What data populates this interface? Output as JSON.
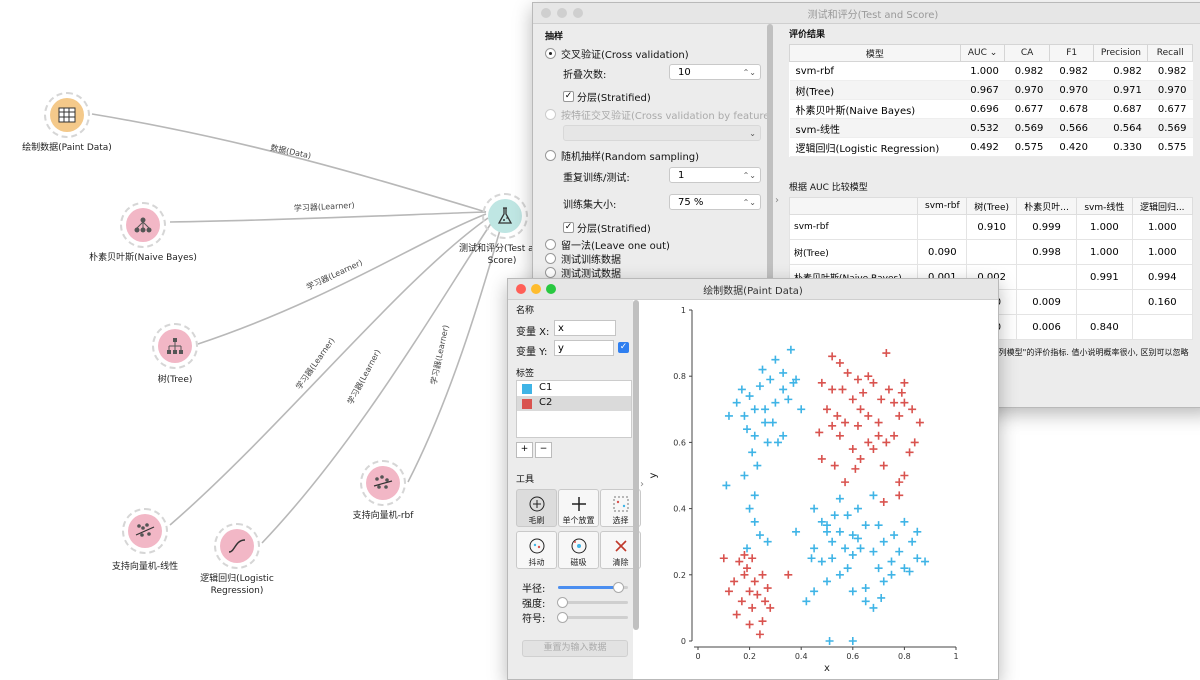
{
  "canvas": {
    "nodes": {
      "paint": {
        "label": "绘制数据(Paint Data)",
        "color": "#f4c98a"
      },
      "naive": {
        "label": "朴素贝叶斯(Naive Bayes)",
        "color": "#f2b7c6"
      },
      "tree": {
        "label": "树(Tree)",
        "color": "#f2b7c6"
      },
      "svm_linear": {
        "label": "支持向量机-线性",
        "color": "#f2b7c6"
      },
      "logreg": {
        "label": "逻辑回归(Logistic Regression)",
        "color": "#f2b7c6"
      },
      "svm_rbf": {
        "label": "支持向量机-rbf",
        "color": "#f2b7c6"
      },
      "test": {
        "label": "测试和评分(Test and Score)",
        "color": "#bfe6e3"
      }
    },
    "edges": {
      "data": "数据(Data)",
      "learner": "学习器(Learner)"
    }
  },
  "ts": {
    "title": "测试和评分(Test and Score)",
    "sampling_title": "抽样",
    "cv": "交叉验证(Cross validation)",
    "folds_label": "折叠次数:",
    "folds": "10",
    "stratified": "分层(Stratified)",
    "cv_feature": "按特征交叉验证(Cross validation by feature)",
    "random": "随机抽样(Random sampling)",
    "repeat_label": "重复训练/测试:",
    "repeat": "1",
    "size_label": "训练集大小:",
    "size": "75 %",
    "stratified2": "分层(Stratified)",
    "loo": "留一法(Leave one out)",
    "test_train": "测试训练数据",
    "test_test": "测试测试数据",
    "results_title": "评价结果",
    "cols": [
      "模型",
      "AUC ⌄",
      "CA",
      "F1",
      "Precision",
      "Recall"
    ],
    "rows": [
      [
        "svm-rbf",
        "1.000",
        "0.982",
        "0.982",
        "0.982",
        "0.982"
      ],
      [
        "树(Tree)",
        "0.967",
        "0.970",
        "0.970",
        "0.971",
        "0.970"
      ],
      [
        "朴素贝叶斯(Naive Bayes)",
        "0.696",
        "0.677",
        "0.678",
        "0.687",
        "0.677"
      ],
      [
        "svm-线性",
        "0.532",
        "0.569",
        "0.566",
        "0.564",
        "0.569"
      ],
      [
        "逻辑回归(Logistic Regression)",
        "0.492",
        "0.575",
        "0.420",
        "0.330",
        "0.575"
      ]
    ],
    "compare_title": "根据 AUC 比较模型",
    "cmp_cols": [
      "",
      "svm-rbf",
      "树(Tree)",
      "朴素贝叶...",
      "svm-线性",
      "逻辑回归..."
    ],
    "cmp_rows": [
      [
        "svm-rbf",
        "",
        "0.910",
        "0.999",
        "1.000",
        "1.000"
      ],
      [
        "树(Tree)",
        "0.090",
        "",
        "0.998",
        "1.000",
        "1.000"
      ],
      [
        "朴素贝叶斯(Naive Bayes)",
        "0.001",
        "0.002",
        "",
        "0.991",
        "0.994"
      ],
      [
        "",
        "",
        "000",
        "0.009",
        "",
        "0.160"
      ],
      [
        "",
        "",
        "000",
        "0.006",
        "0.840",
        ""
      ]
    ],
    "note": "\"列模型\"的评价指标. 值小说明概率很小, 区别可以忽略"
  },
  "pd": {
    "title": "绘制数据(Paint Data)",
    "name_title": "名称",
    "varx_label": "变量 X:",
    "varx": "x",
    "vary_label": "变量 Y:",
    "vary": "y",
    "labels_title": "标签",
    "labels": [
      {
        "name": "C1",
        "color": "#3fb4e6"
      },
      {
        "name": "C2",
        "color": "#d9534f"
      }
    ],
    "add": "+",
    "remove": "−",
    "tools_title": "工具",
    "tools": [
      "毛刷",
      "单个放置",
      "选择",
      "抖动",
      "磁吸",
      "清除"
    ],
    "radius_label": "半径:",
    "intensity_label": "强度:",
    "symbol_label": "符号:",
    "reset": "重置为输入数据",
    "radius_value": 0.85,
    "intensity_value": 0.05,
    "symbol_value": 0.05
  },
  "chart_data": {
    "type": "scatter",
    "xlabel": "x",
    "ylabel": "y",
    "xlim": [
      0,
      1
    ],
    "ylim": [
      0,
      1
    ],
    "xticks": [
      "0",
      "0.2",
      "0.4",
      "0.6",
      "0.8",
      "1"
    ],
    "yticks": [
      "0",
      "0.2",
      "0.4",
      "0.6",
      "0.8",
      "1"
    ],
    "series": [
      {
        "name": "C1",
        "color": "#3fb4e6",
        "points": [
          [
            0.3,
            0.85
          ],
          [
            0.36,
            0.88
          ],
          [
            0.33,
            0.81
          ],
          [
            0.38,
            0.79
          ],
          [
            0.25,
            0.82
          ],
          [
            0.28,
            0.79
          ],
          [
            0.2,
            0.74
          ],
          [
            0.22,
            0.7
          ],
          [
            0.18,
            0.68
          ],
          [
            0.26,
            0.66
          ],
          [
            0.3,
            0.72
          ],
          [
            0.33,
            0.76
          ],
          [
            0.35,
            0.73
          ],
          [
            0.4,
            0.7
          ],
          [
            0.37,
            0.78
          ],
          [
            0.24,
            0.77
          ],
          [
            0.15,
            0.72
          ],
          [
            0.12,
            0.68
          ],
          [
            0.19,
            0.64
          ],
          [
            0.22,
            0.62
          ],
          [
            0.27,
            0.6
          ],
          [
            0.31,
            0.6
          ],
          [
            0.33,
            0.62
          ],
          [
            0.21,
            0.57
          ],
          [
            0.23,
            0.53
          ],
          [
            0.18,
            0.5
          ],
          [
            0.11,
            0.47
          ],
          [
            0.29,
            0.66
          ],
          [
            0.17,
            0.76
          ],
          [
            0.26,
            0.7
          ],
          [
            0.2,
            0.4
          ],
          [
            0.22,
            0.36
          ],
          [
            0.24,
            0.32
          ],
          [
            0.19,
            0.28
          ],
          [
            0.27,
            0.3
          ],
          [
            0.22,
            0.44
          ],
          [
            0.38,
            0.33
          ],
          [
            0.45,
            0.28
          ],
          [
            0.48,
            0.36
          ],
          [
            0.5,
            0.33
          ],
          [
            0.52,
            0.3
          ],
          [
            0.55,
            0.33
          ],
          [
            0.57,
            0.28
          ],
          [
            0.6,
            0.26
          ],
          [
            0.62,
            0.31
          ],
          [
            0.65,
            0.35
          ],
          [
            0.68,
            0.27
          ],
          [
            0.7,
            0.22
          ],
          [
            0.72,
            0.18
          ],
          [
            0.75,
            0.24
          ],
          [
            0.78,
            0.27
          ],
          [
            0.8,
            0.22
          ],
          [
            0.83,
            0.3
          ],
          [
            0.85,
            0.25
          ],
          [
            0.88,
            0.24
          ],
          [
            0.58,
            0.22
          ],
          [
            0.52,
            0.25
          ],
          [
            0.48,
            0.24
          ],
          [
            0.44,
            0.25
          ],
          [
            0.42,
            0.12
          ],
          [
            0.45,
            0.15
          ],
          [
            0.5,
            0.18
          ],
          [
            0.55,
            0.2
          ],
          [
            0.6,
            0.15
          ],
          [
            0.65,
            0.12
          ],
          [
            0.65,
            0.16
          ],
          [
            0.71,
            0.13
          ],
          [
            0.68,
            0.1
          ],
          [
            0.75,
            0.2
          ],
          [
            0.62,
            0.4
          ],
          [
            0.68,
            0.44
          ],
          [
            0.7,
            0.35
          ],
          [
            0.72,
            0.3
          ],
          [
            0.76,
            0.32
          ],
          [
            0.8,
            0.36
          ],
          [
            0.58,
            0.38
          ],
          [
            0.55,
            0.43
          ],
          [
            0.6,
            0.32
          ],
          [
            0.63,
            0.28
          ],
          [
            0.45,
            0.4
          ],
          [
            0.5,
            0.35
          ],
          [
            0.53,
            0.38
          ],
          [
            0.85,
            0.33
          ],
          [
            0.82,
            0.21
          ],
          [
            0.6,
            0.0
          ],
          [
            0.51,
            0.0
          ]
        ]
      },
      {
        "name": "C2",
        "color": "#d9534f",
        "points": [
          [
            0.52,
            0.86
          ],
          [
            0.55,
            0.84
          ],
          [
            0.58,
            0.81
          ],
          [
            0.62,
            0.79
          ],
          [
            0.66,
            0.8
          ],
          [
            0.73,
            0.87
          ],
          [
            0.8,
            0.78
          ],
          [
            0.68,
            0.78
          ],
          [
            0.74,
            0.76
          ],
          [
            0.76,
            0.72
          ],
          [
            0.71,
            0.73
          ],
          [
            0.64,
            0.75
          ],
          [
            0.6,
            0.73
          ],
          [
            0.56,
            0.76
          ],
          [
            0.52,
            0.76
          ],
          [
            0.48,
            0.78
          ],
          [
            0.5,
            0.7
          ],
          [
            0.54,
            0.68
          ],
          [
            0.57,
            0.66
          ],
          [
            0.62,
            0.65
          ],
          [
            0.63,
            0.7
          ],
          [
            0.66,
            0.68
          ],
          [
            0.7,
            0.62
          ],
          [
            0.73,
            0.6
          ],
          [
            0.76,
            0.62
          ],
          [
            0.78,
            0.68
          ],
          [
            0.8,
            0.72
          ],
          [
            0.83,
            0.7
          ],
          [
            0.79,
            0.75
          ],
          [
            0.86,
            0.66
          ],
          [
            0.84,
            0.6
          ],
          [
            0.82,
            0.57
          ],
          [
            0.8,
            0.5
          ],
          [
            0.78,
            0.48
          ],
          [
            0.72,
            0.53
          ],
          [
            0.68,
            0.58
          ],
          [
            0.63,
            0.55
          ],
          [
            0.6,
            0.58
          ],
          [
            0.55,
            0.62
          ],
          [
            0.52,
            0.65
          ],
          [
            0.47,
            0.63
          ],
          [
            0.48,
            0.55
          ],
          [
            0.53,
            0.53
          ],
          [
            0.57,
            0.48
          ],
          [
            0.61,
            0.52
          ],
          [
            0.78,
            0.44
          ],
          [
            0.72,
            0.42
          ],
          [
            0.66,
            0.6
          ],
          [
            0.7,
            0.66
          ],
          [
            0.16,
            0.24
          ],
          [
            0.19,
            0.22
          ],
          [
            0.21,
            0.25
          ],
          [
            0.18,
            0.2
          ],
          [
            0.14,
            0.18
          ],
          [
            0.2,
            0.15
          ],
          [
            0.22,
            0.18
          ],
          [
            0.25,
            0.2
          ],
          [
            0.17,
            0.12
          ],
          [
            0.21,
            0.1
          ],
          [
            0.23,
            0.14
          ],
          [
            0.26,
            0.12
          ],
          [
            0.15,
            0.08
          ],
          [
            0.2,
            0.05
          ],
          [
            0.24,
            0.02
          ],
          [
            0.1,
            0.25
          ],
          [
            0.12,
            0.15
          ],
          [
            0.28,
            0.1
          ],
          [
            0.27,
            0.16
          ],
          [
            0.35,
            0.2
          ],
          [
            0.18,
            0.26
          ],
          [
            0.25,
            0.06
          ]
        ]
      }
    ]
  }
}
